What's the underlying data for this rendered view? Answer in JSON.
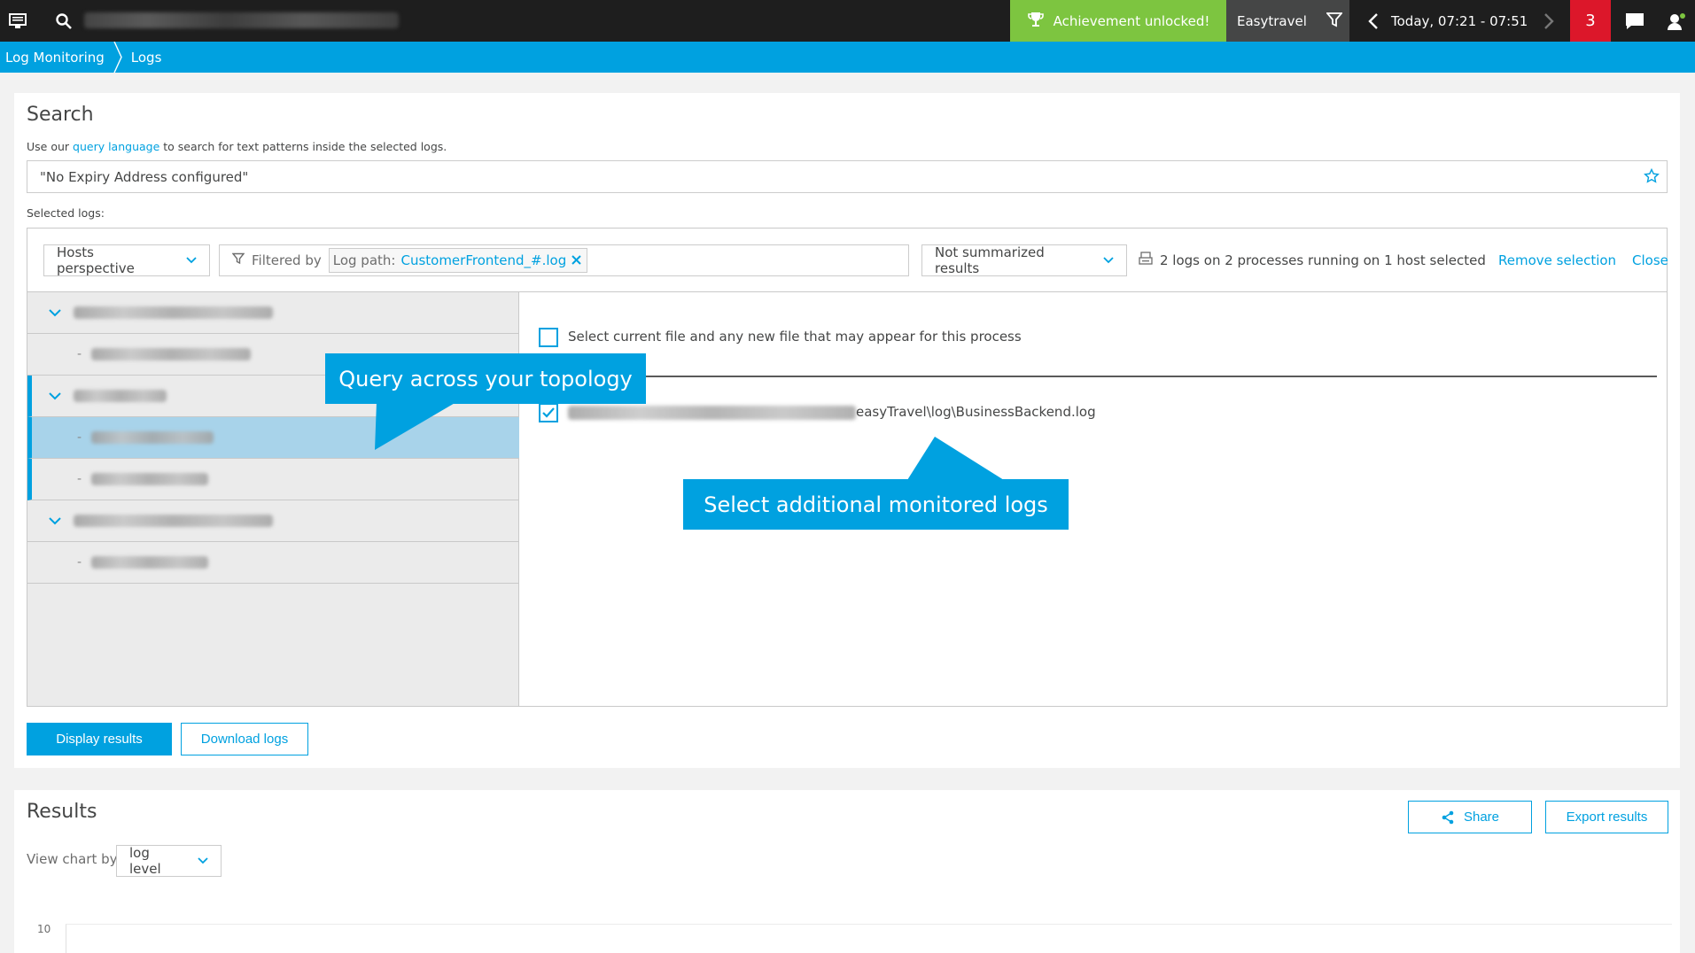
{
  "topbar": {
    "achievement_label": "Achievement unlocked!",
    "app_name": "Easytravel",
    "timeframe": "Today, 07:21 - 07:51",
    "alert_count": "3"
  },
  "breadcrumb": [
    "Log Monitoring",
    "Logs"
  ],
  "search": {
    "title": "Search",
    "hint_prefix": "Use our ",
    "hint_link": "query language",
    "hint_suffix": " to search for text patterns inside the selected logs.",
    "query_value": "\"No Expiry Address configured\"",
    "selected_logs_label": "Selected logs:"
  },
  "toolbar": {
    "perspective": "Hosts perspective",
    "filtered_by": "Filtered by",
    "filter_key": "Log path:",
    "filter_value": "CustomerFrontend_#.log",
    "summary_mode": "Not summarized results",
    "logs_info": "2 logs on 2 processes running on 1 host selected",
    "remove_selection": "Remove selection",
    "close": "Close"
  },
  "files": {
    "select_current": "Select current file and any new file that may appear for this process",
    "file_path_suffix": "easyTravel\\log\\BusinessBackend.log"
  },
  "tips": {
    "topology": "Query across your topology",
    "additional": "Select additional monitored logs"
  },
  "buttons": {
    "display_results": "Display results",
    "download_logs": "Download logs",
    "share": "Share",
    "export_results": "Export results"
  },
  "results": {
    "title": "Results",
    "view_chart_by": "View chart by",
    "chart_by_value": "log level",
    "y_tick": "10"
  },
  "colors": {
    "accent": "#00a1e0",
    "achievement": "#7dc540",
    "alert": "#dc172a",
    "topbar": "#1e1e1e"
  }
}
